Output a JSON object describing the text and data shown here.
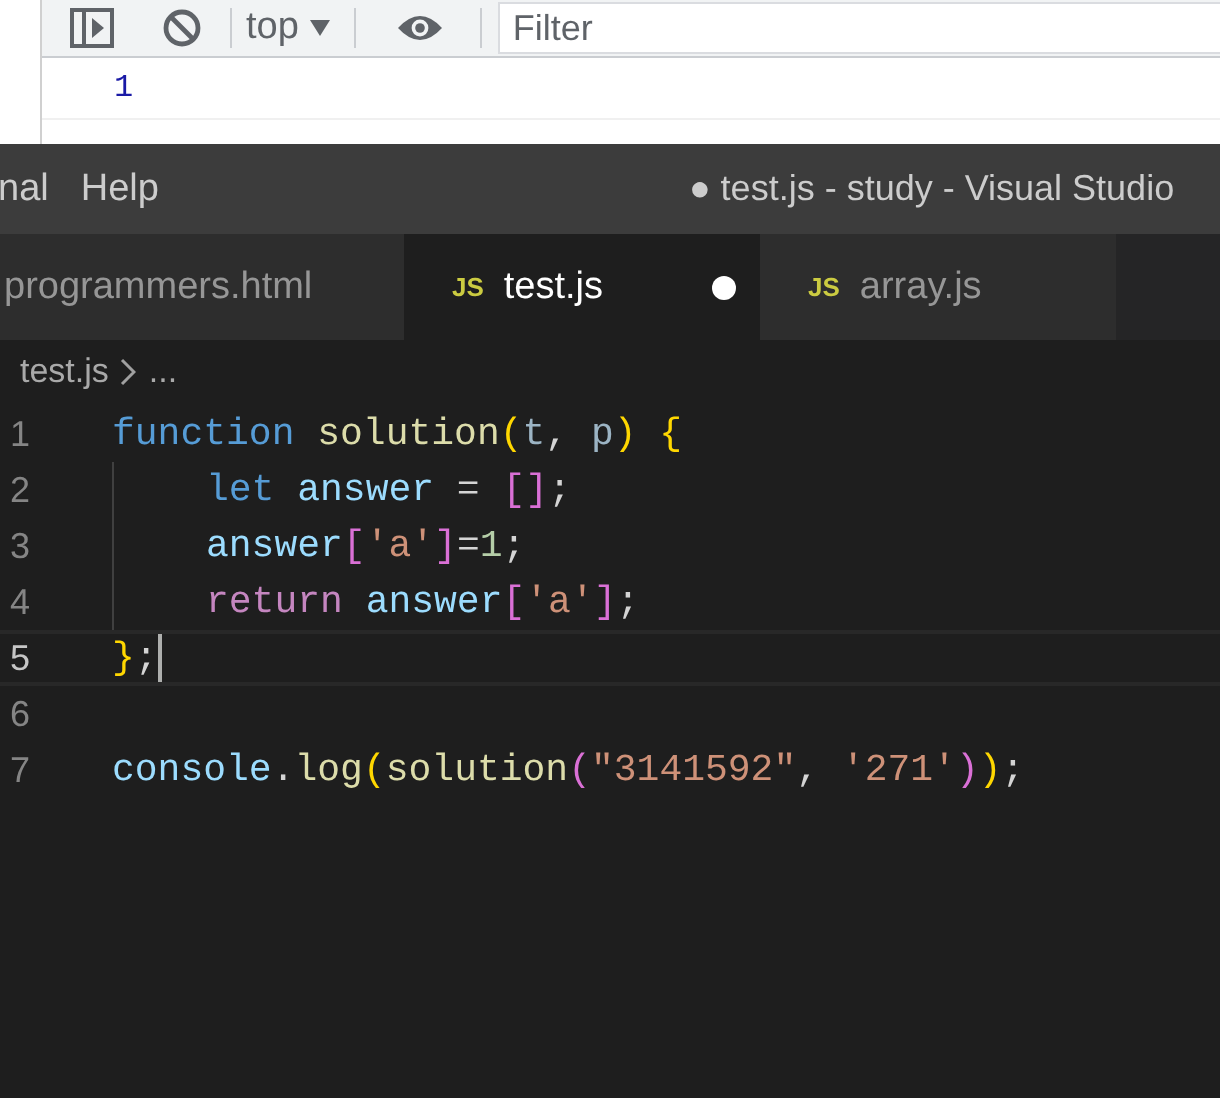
{
  "devtools": {
    "context": "top",
    "filter": {
      "placeholder": "Filter"
    },
    "console": [
      "1"
    ]
  },
  "vscode": {
    "menu": [
      "nal",
      "Help"
    ],
    "title": "● test.js - study - Visual Studio",
    "tabs": [
      {
        "label": "programmers.html",
        "selected": false,
        "modified": false
      },
      {
        "label": "test.js",
        "icon": "JS",
        "selected": true,
        "modified": true
      },
      {
        "label": "array.js",
        "icon": "JS",
        "selected": false,
        "modified": false
      }
    ],
    "breadcrumb": [
      "test.js",
      "..."
    ],
    "lines": [
      {
        "number": "1",
        "active": false,
        "indent": false,
        "tokens": [
          {
            "kind": "keyword",
            "text": "function "
          },
          {
            "kind": "func",
            "text": "solution"
          },
          {
            "kind": "bracket1",
            "text": "("
          },
          {
            "kind": "param",
            "text": "t"
          },
          {
            "kind": "plain",
            "text": ", "
          },
          {
            "kind": "param",
            "text": "p"
          },
          {
            "kind": "bracket1",
            "text": ") {"
          }
        ]
      },
      {
        "number": "2",
        "active": false,
        "indent": true,
        "tokens": [
          {
            "kind": "keyword",
            "text": "let "
          },
          {
            "kind": "variable",
            "text": "answer"
          },
          {
            "kind": "plain",
            "text": " = "
          },
          {
            "kind": "bracket2",
            "text": "[]"
          },
          {
            "kind": "plain",
            "text": ";"
          }
        ]
      },
      {
        "number": "3",
        "active": false,
        "indent": true,
        "tokens": [
          {
            "kind": "variable",
            "text": "answer"
          },
          {
            "kind": "bracket2",
            "text": "["
          },
          {
            "kind": "string",
            "text": "'a'"
          },
          {
            "kind": "bracket2",
            "text": "]"
          },
          {
            "kind": "plain",
            "text": "="
          },
          {
            "kind": "number",
            "text": "1"
          },
          {
            "kind": "plain",
            "text": ";"
          }
        ]
      },
      {
        "number": "4",
        "active": false,
        "indent": true,
        "tokens": [
          {
            "kind": "control",
            "text": "return "
          },
          {
            "kind": "variable",
            "text": "answer"
          },
          {
            "kind": "bracket2",
            "text": "["
          },
          {
            "kind": "string",
            "text": "'a'"
          },
          {
            "kind": "bracket2",
            "text": "]"
          },
          {
            "kind": "plain",
            "text": ";"
          }
        ]
      },
      {
        "number": "5",
        "active": true,
        "indent": false,
        "tokens": [
          {
            "kind": "bracket1",
            "text": "}"
          },
          {
            "kind": "plain",
            "text": ";"
          }
        ]
      },
      {
        "number": "6",
        "active": false,
        "indent": false
      },
      {
        "number": "7",
        "active": false,
        "indent": false,
        "tokens": [
          {
            "kind": "variable",
            "text": "console"
          },
          {
            "kind": "plain",
            "text": "."
          },
          {
            "kind": "func",
            "text": "log"
          },
          {
            "kind": "bracket1",
            "text": "("
          },
          {
            "kind": "func",
            "text": "solution"
          },
          {
            "kind": "bracket2",
            "text": "("
          },
          {
            "kind": "string",
            "text": "\"3141592\""
          },
          {
            "kind": "plain",
            "text": ", "
          },
          {
            "kind": "string",
            "text": "'271'"
          },
          {
            "kind": "bracket2",
            "text": ")"
          },
          {
            "kind": "bracket1",
            "text": ")"
          },
          {
            "kind": "plain",
            "text": ";"
          }
        ]
      }
    ]
  }
}
